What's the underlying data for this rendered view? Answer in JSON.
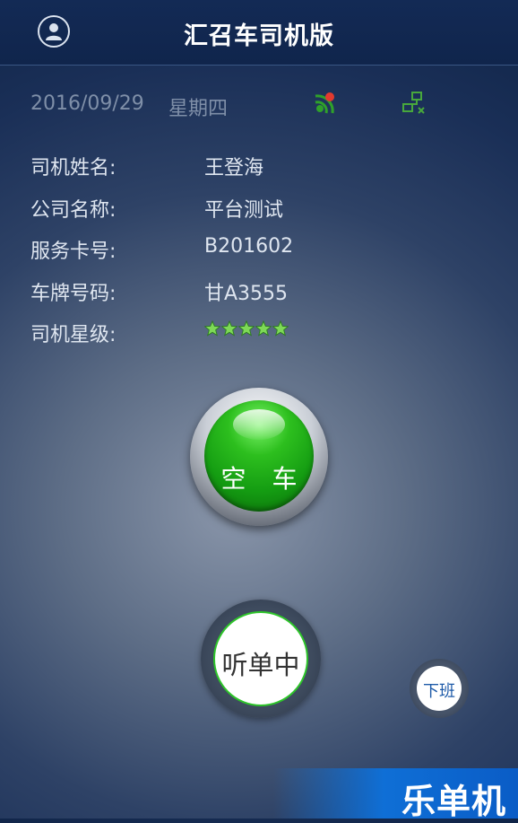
{
  "header": {
    "title": "汇召车司机版",
    "avatar_icon": "user-icon"
  },
  "info": {
    "date": "2016/09/29",
    "weekday": "星期四",
    "gps_icon": "gps-signal-icon",
    "network_icon": "network-icon"
  },
  "fields": [
    {
      "label": "司机姓名:",
      "value": "王登海"
    },
    {
      "label": "公司名称:",
      "value": "平台测试"
    },
    {
      "label": "服务卡号:",
      "value": "B201602"
    },
    {
      "label": "车牌号码:",
      "value": "甘A3555"
    },
    {
      "label": "司机星级:",
      "value": ""
    }
  ],
  "rating": {
    "stars": 5,
    "max": 5,
    "color": "#7ed957"
  },
  "buttons": {
    "status": "空 车",
    "listen": "听单中",
    "off_duty": "下班"
  },
  "watermark": "乐单机",
  "colors": {
    "header_bg": "#10254c",
    "accent_green": "#1fa81a",
    "off_duty_text": "#1d5aa8"
  }
}
